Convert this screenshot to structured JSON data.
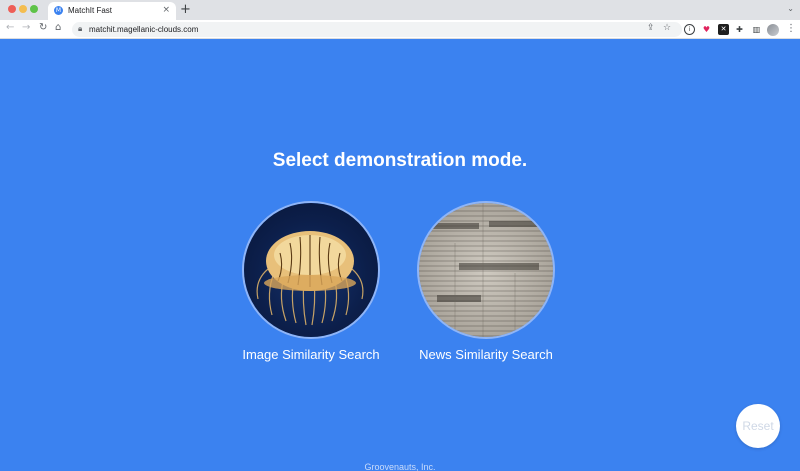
{
  "browser": {
    "tab_title": "MatchIt Fast",
    "tab_close": "×",
    "new_tab": "+",
    "favicon_letter": "M",
    "url": "matchit.magellanic-clouds.com"
  },
  "page": {
    "heading": "Select demonstration mode.",
    "modes": [
      {
        "label": "Image Similarity Search",
        "icon": "jellyfish-image"
      },
      {
        "label": "News Similarity Search",
        "icon": "newspaper-image"
      }
    ],
    "reset_label": "Reset",
    "footer": "Groovenauts, Inc."
  },
  "colors": {
    "page_background": "#3b82f0",
    "circle_border": "#8fb5f7"
  }
}
